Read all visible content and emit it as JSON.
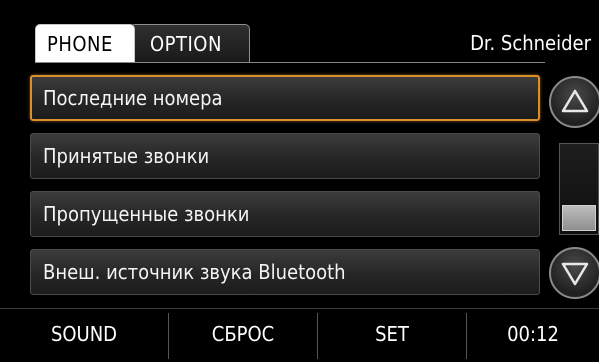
{
  "tabs": [
    {
      "label": "PHONE",
      "active": true
    },
    {
      "label": "OPTION",
      "active": false
    }
  ],
  "profile_name": "Dr. Schneider",
  "list": [
    {
      "label": "Последние номера",
      "selected": true
    },
    {
      "label": "Принятые звонки",
      "selected": false
    },
    {
      "label": "Пропущенные звонки",
      "selected": false
    },
    {
      "label": "Внеш. источник звука Bluetooth",
      "selected": false
    }
  ],
  "scroll": {
    "up_icon": "triangle-up-icon",
    "down_icon": "triangle-down-icon",
    "position": 1.0
  },
  "bottom_bar": {
    "sound_label": "SOUND",
    "reset_label": "СБРОС",
    "set_label": "SET",
    "clock": "00:12"
  },
  "colors": {
    "selection_border": "#d9902a",
    "background": "#000000",
    "active_tab": "#ffffff"
  }
}
